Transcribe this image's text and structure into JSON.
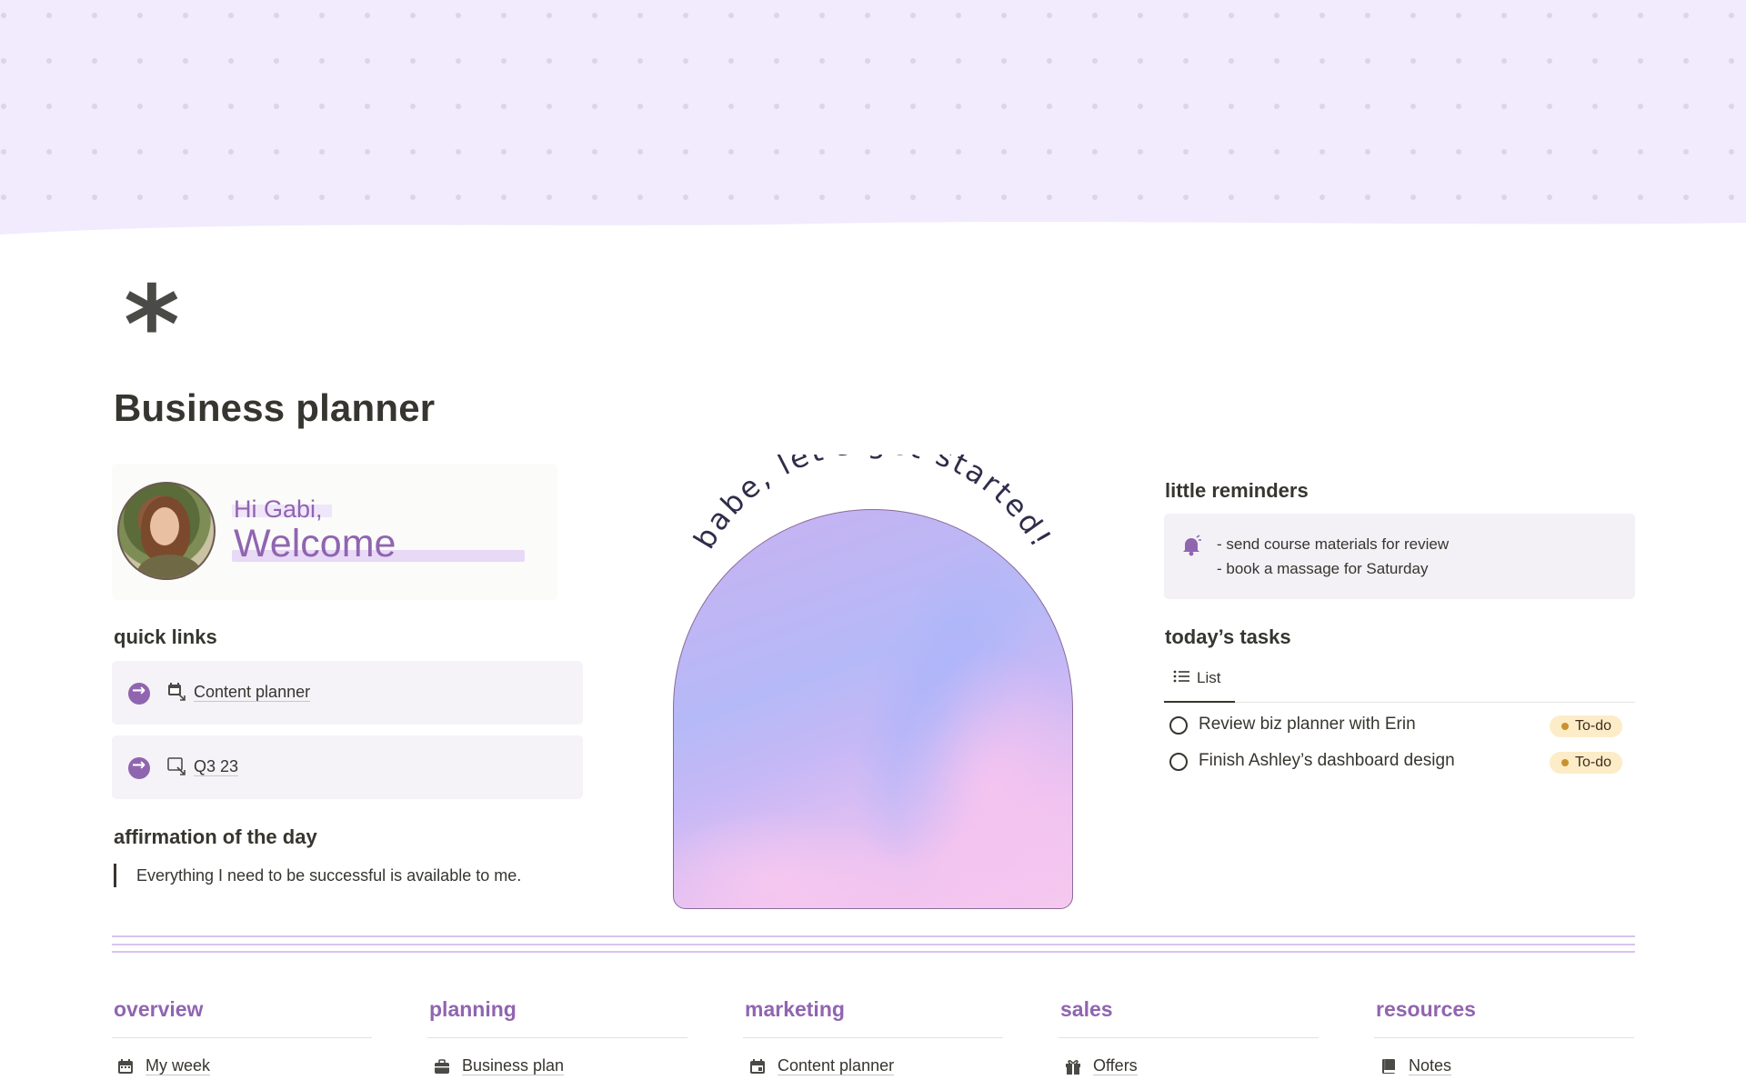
{
  "page": {
    "icon": "asterisk-icon",
    "title": "Business planner"
  },
  "welcome": {
    "greeting": "Hi Gabi,",
    "headline": "Welcome",
    "avatar": "user-avatar"
  },
  "quick_links": {
    "title": "quick links",
    "items": [
      {
        "label": "Content planner",
        "icon": "calendar-link-icon"
      },
      {
        "label": "Q3 23",
        "icon": "window-link-icon"
      }
    ]
  },
  "affirmation": {
    "title": "affirmation of the day",
    "text": "Everything I need to be successful is available to me."
  },
  "arch": {
    "caption": "babe, let's get started!"
  },
  "reminders": {
    "title": "little reminders",
    "icon": "bell-icon",
    "lines": [
      "- send course materials for review",
      "- book a massage for Saturday"
    ]
  },
  "tasks": {
    "title": "today’s tasks",
    "view_label": "List",
    "items": [
      {
        "label": "Review biz planner with Erin",
        "status": "To-do"
      },
      {
        "label": "Finish Ashley’s dashboard design",
        "status": "To-do"
      }
    ]
  },
  "footer": {
    "columns": [
      {
        "title": "overview",
        "item": "My week",
        "icon": "calendar-icon"
      },
      {
        "title": "planning",
        "item": "Business plan",
        "icon": "briefcase-icon"
      },
      {
        "title": "marketing",
        "item": "Content planner",
        "icon": "calendar-icon"
      },
      {
        "title": "sales",
        "item": "Offers",
        "icon": "gift-icon"
      },
      {
        "title": "resources",
        "item": "Notes",
        "icon": "book-icon"
      }
    ]
  },
  "colors": {
    "accent": "#9065b0",
    "cover": "#f1ebfd",
    "badge_bg": "#fdecc8"
  }
}
